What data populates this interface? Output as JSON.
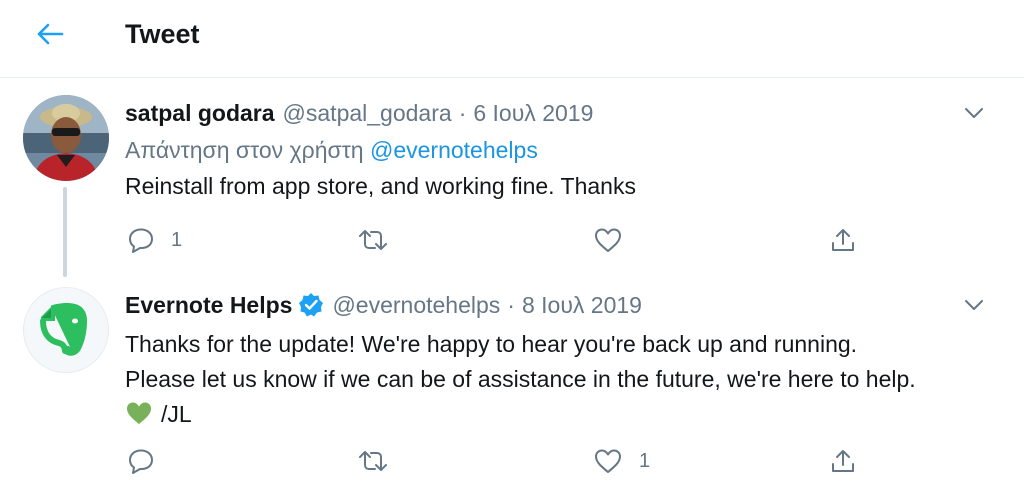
{
  "header": {
    "title": "Tweet",
    "back_icon": "arrow-left-icon",
    "accent": "#1da1f2"
  },
  "tweets": [
    {
      "name": "satpal godara",
      "handle": "@satpal_godara",
      "separator": "·",
      "date": "6 Ιουλ 2019",
      "replying_prefix": "Απάντηση στον χρήστη",
      "replying_mention": "@evernotehelps",
      "text": "Reinstall from app store, and working fine. Thanks",
      "reply_count": "1",
      "retweet_count": "",
      "like_count": ""
    },
    {
      "name": "Evernote Helps",
      "verified": true,
      "handle": "@evernotehelps",
      "separator": "·",
      "date": "8 Ιουλ 2019",
      "text_line1": "Thanks for the update! We're happy to hear you're back up and running.",
      "text_line2": "Please let us know if we can be of assistance in the future, we're here to help.",
      "text_sign": "/JL",
      "reply_count": "",
      "retweet_count": "",
      "like_count": "1"
    }
  ],
  "colors": {
    "text": "#14171a",
    "muted": "#657786",
    "link": "#1b95e0",
    "verified": "#1da1f2",
    "evernote_green": "#2dbe60",
    "heart_emoji": "#78b159"
  }
}
